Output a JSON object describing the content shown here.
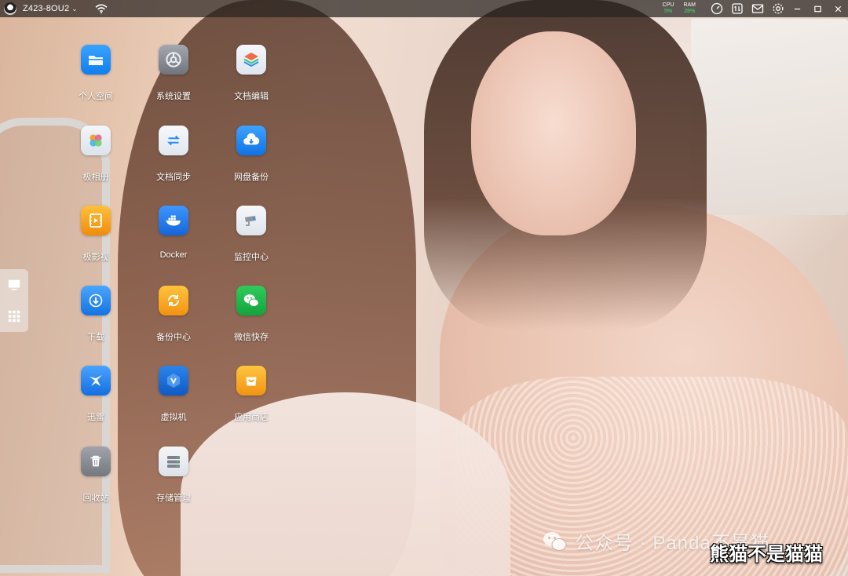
{
  "topbar": {
    "device_name": "Z423-8OU2",
    "device_avatar_icon": "panda-avatar-icon",
    "dropdown_icon": "chevron-down-icon",
    "network_icon": "wifi-icon",
    "cpu": {
      "label": "CPU",
      "value": "5%"
    },
    "ram": {
      "label": "RAM",
      "value": "28%"
    },
    "icons": [
      "speedometer-icon",
      "transfer-icon",
      "mail-icon",
      "gear-icon",
      "minimize-icon",
      "maximize-icon",
      "close-icon"
    ],
    "stat_value_color": "#3ee06a"
  },
  "sidedock": {
    "items": [
      {
        "icon": "monitor-icon"
      },
      {
        "icon": "app-grid-icon"
      }
    ]
  },
  "apps": [
    {
      "label": "个人空间",
      "icon": "folder-icon",
      "color": "#1e90ff"
    },
    {
      "label": "系统设置",
      "icon": "settings-icon",
      "color": "#8a8f97"
    },
    {
      "label": "文档编辑",
      "icon": "layers-icon",
      "color": "#e9eef5"
    },
    {
      "label": "极相册",
      "icon": "photo-album-icon",
      "color": "#e8edf4"
    },
    {
      "label": "文档同步",
      "icon": "sync-arrows-icon",
      "color": "#eef2f7"
    },
    {
      "label": "网盘备份",
      "icon": "cloud-backup-icon",
      "color": "#1c86f2"
    },
    {
      "label": "极影视",
      "icon": "film-icon",
      "color": "#f7a21b"
    },
    {
      "label": "Docker",
      "icon": "docker-whale-icon",
      "color": "#1f7ff0"
    },
    {
      "label": "监控中心",
      "icon": "security-camera-icon",
      "color": "#eceff3"
    },
    {
      "label": "下载",
      "icon": "download-icon",
      "color": "#2a8cf5"
    },
    {
      "label": "备份中心",
      "icon": "backup-cycle-icon",
      "color": "#f6a619"
    },
    {
      "label": "微信快存",
      "icon": "wechat-icon",
      "color": "#22b14c"
    },
    {
      "label": "迅雷",
      "icon": "thunder-bird-icon",
      "color": "#2b86ee"
    },
    {
      "label": "虚拟机",
      "icon": "virtual-machine-icon",
      "color": "#1a6fd6"
    },
    {
      "label": "应用商店",
      "icon": "app-store-bag-icon",
      "color": "#f6a61c"
    },
    {
      "label": "回收站",
      "icon": "trash-icon",
      "color": "#8e9298"
    },
    {
      "label": "存储管理",
      "icon": "storage-disk-icon",
      "color": "#e9ecf0"
    }
  ],
  "watermark": {
    "channel": "公众号 · Panda不是猫",
    "caption": "熊猫不是猫猫",
    "icon": "wechat-channel-icon"
  }
}
